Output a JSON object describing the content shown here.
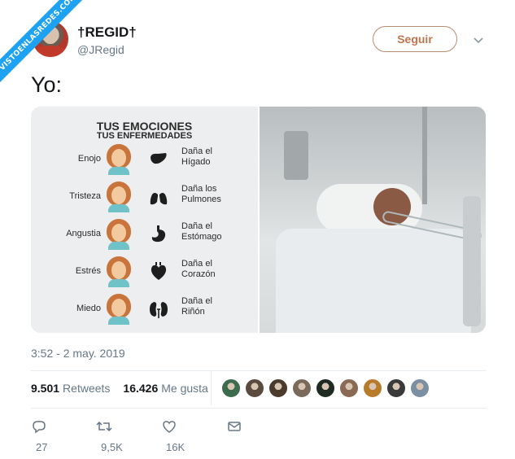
{
  "watermark": "VISTOENLASREDES.COM",
  "author": {
    "name": "†REGID†",
    "handle": "@JRegid"
  },
  "follow_label": "Seguir",
  "tweet_text": "Yo:",
  "infographic": {
    "title": "TUS EMOCIONES",
    "subtitle": "TUS ENFERMEDADES",
    "rows": [
      {
        "emotion": "Enojo",
        "organ_line1": "Daña el",
        "organ_line2": "Hígado",
        "icon": "liver-icon"
      },
      {
        "emotion": "Tristeza",
        "organ_line1": "Daña los",
        "organ_line2": "Pulmones",
        "icon": "lungs-icon"
      },
      {
        "emotion": "Angustia",
        "organ_line1": "Daña el",
        "organ_line2": "Estómago",
        "icon": "stomach-icon"
      },
      {
        "emotion": "Estrés",
        "organ_line1": "Daña el",
        "organ_line2": "Corazón",
        "icon": "heart-icon"
      },
      {
        "emotion": "Miedo",
        "organ_line1": "Daña el",
        "organ_line2": "Riñón",
        "icon": "kidneys-icon"
      }
    ]
  },
  "timestamp": "3:52 - 2 may. 2019",
  "stats": {
    "retweets_count": "9.501",
    "retweets_label": "Retweets",
    "likes_count": "16.426",
    "likes_label": "Me gusta"
  },
  "likers_colors": [
    "#3d6b4e",
    "#5a4a3f",
    "#4a3b2c",
    "#7a6a5c",
    "#1f2a22",
    "#8a6a55",
    "#b77b2a",
    "#3a3a3a",
    "#7b8fa3"
  ],
  "actions": {
    "reply_count": "27",
    "retweet_count": "9,5K",
    "like_count": "16K"
  },
  "colors": {
    "accent": "#1da1f2",
    "follow_border": "#b98b6f",
    "follow_text": "#c0744d",
    "muted": "#657786"
  }
}
